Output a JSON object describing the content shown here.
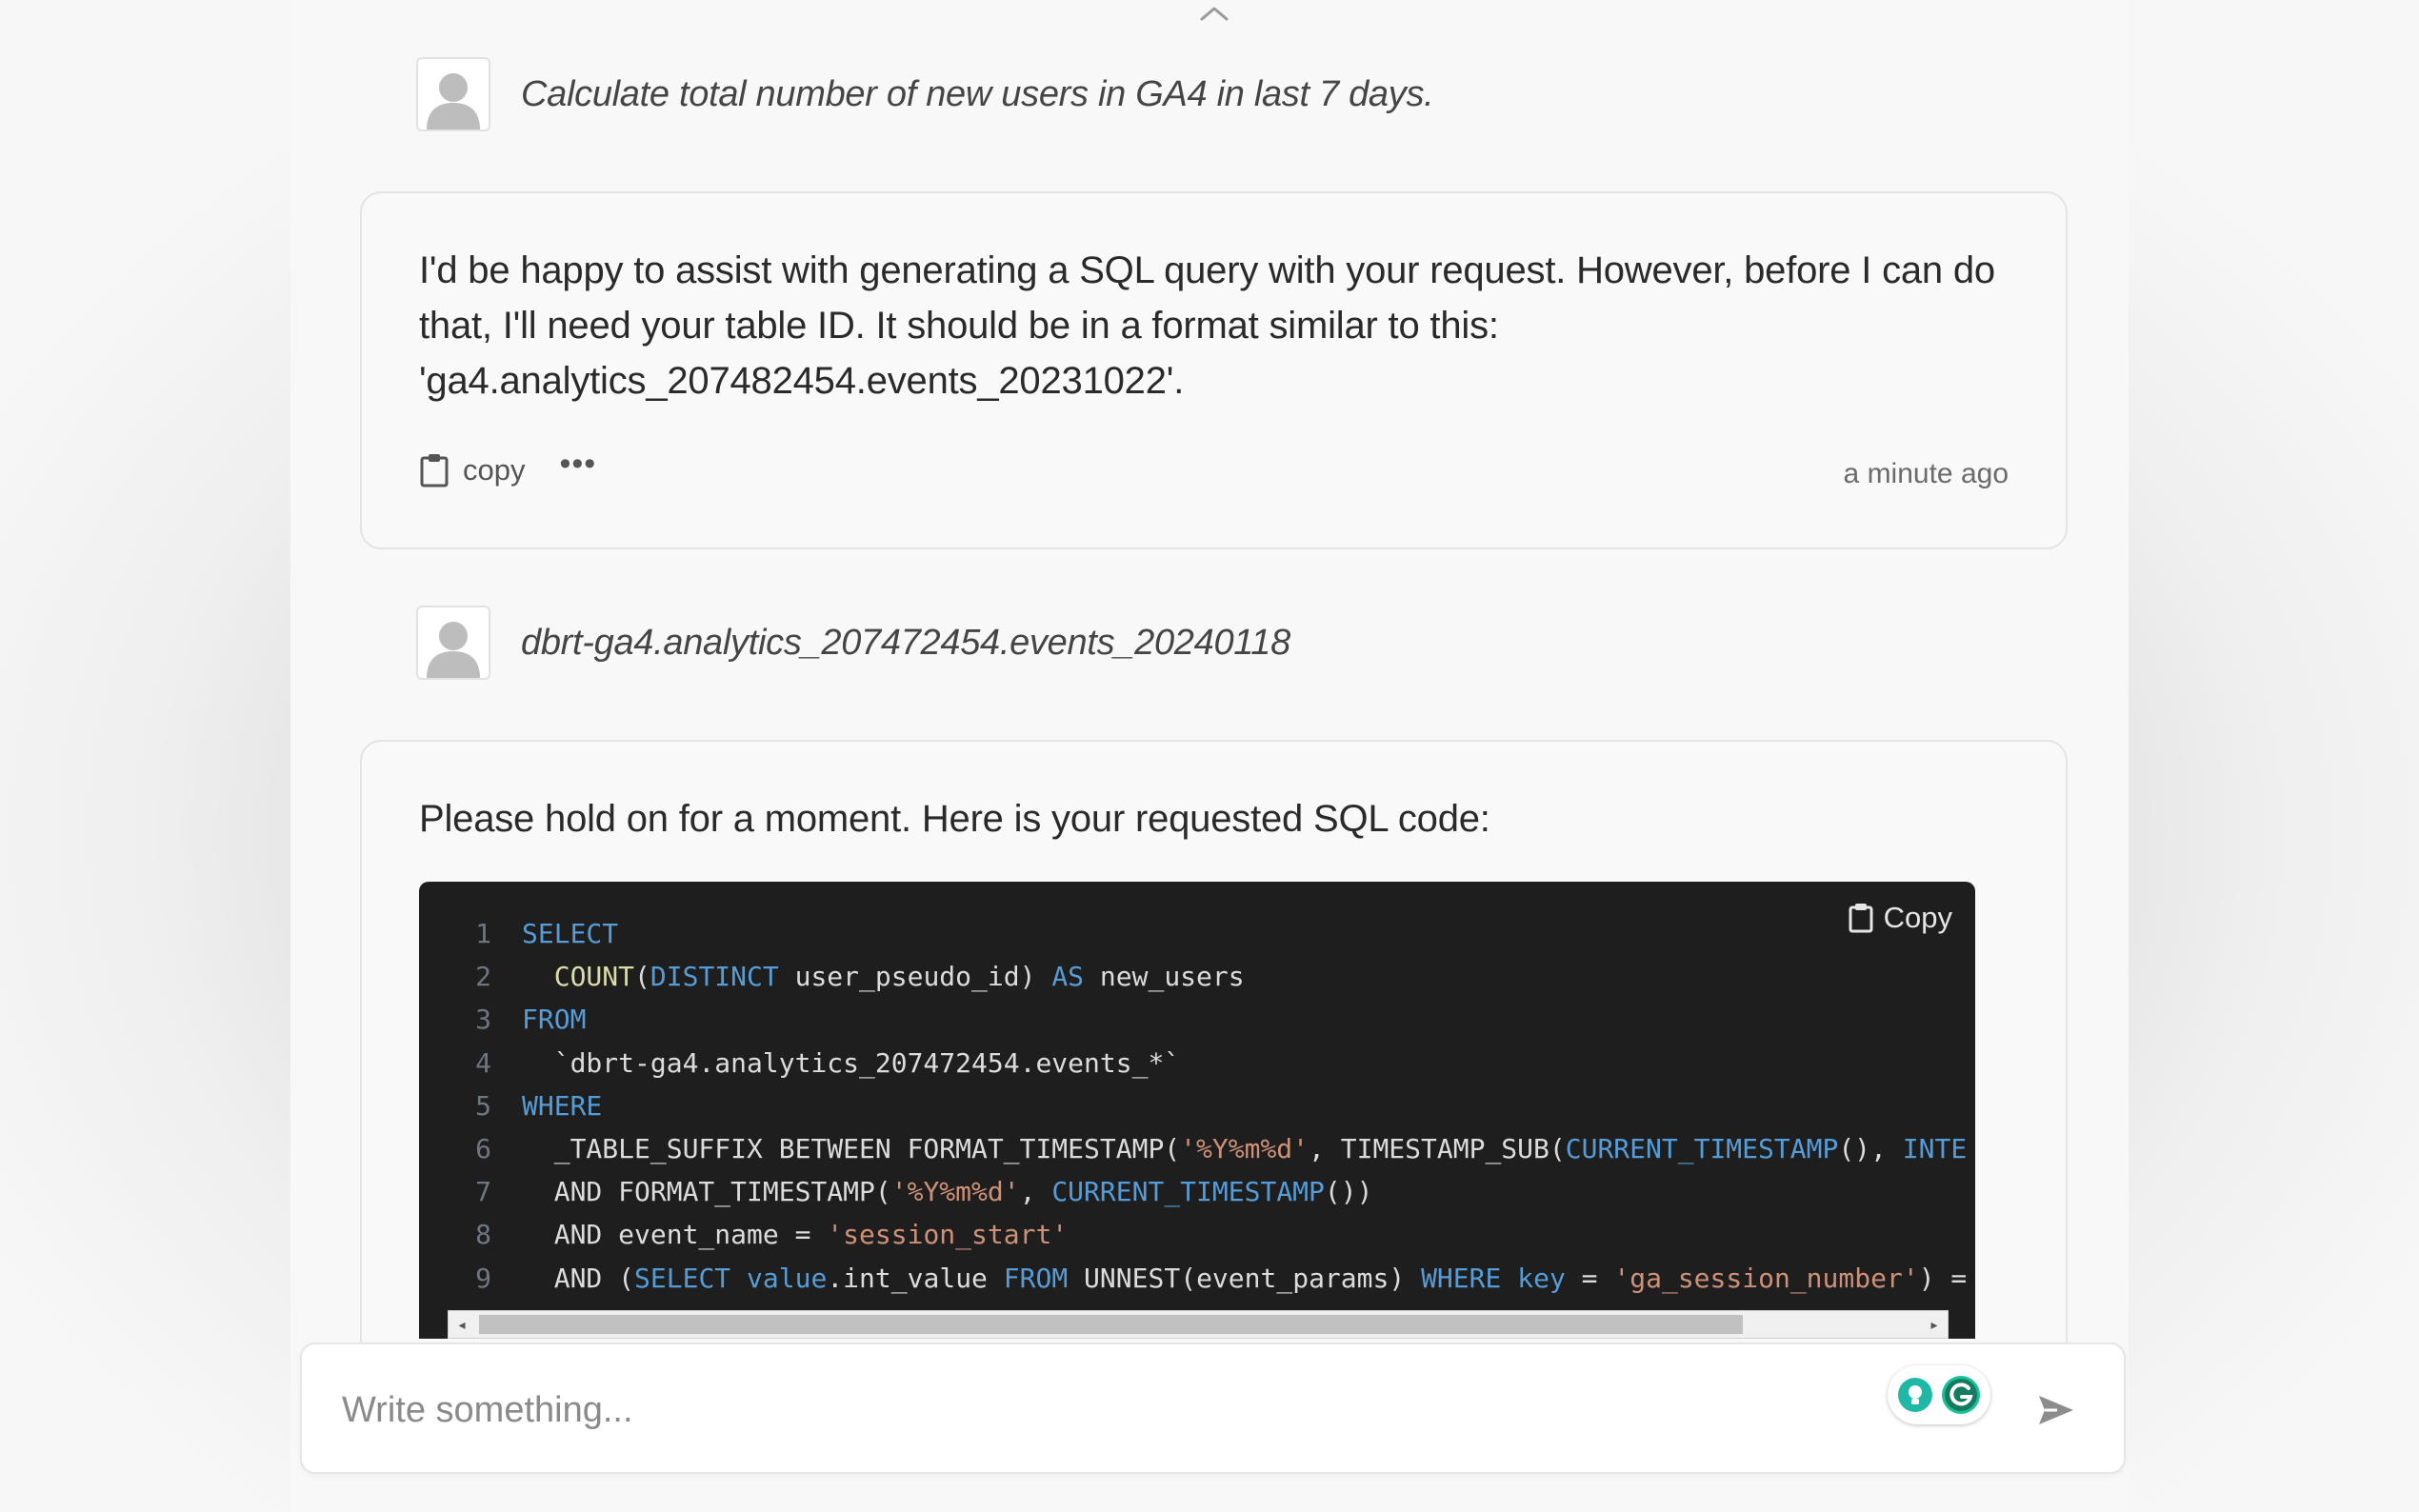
{
  "messages": [
    {
      "role": "user",
      "text": "Calculate total number of new users in GA4 in last 7 days."
    },
    {
      "role": "assistant",
      "text": "I'd be happy to assist with generating a SQL query with your request. However, before I can do that, I'll need your table ID. It should be in a format similar to this: 'ga4.analytics_207482454.events_20231022'.",
      "copy_label": "copy",
      "more_label": "•••",
      "timestamp": "a minute ago"
    },
    {
      "role": "user",
      "text": "dbrt-ga4.analytics_207472454.events_20240118"
    },
    {
      "role": "assistant",
      "text": "Please hold on for a moment. Here is your requested SQL code:",
      "code": {
        "copy_label": "Copy",
        "language": "sql",
        "lines": [
          {
            "num": "1",
            "tokens": [
              {
                "t": "SELECT",
                "c": "kw"
              }
            ]
          },
          {
            "num": "2",
            "tokens": [
              {
                "t": "  ",
                "c": ""
              },
              {
                "t": "COUNT",
                "c": "fn"
              },
              {
                "t": "(",
                "c": ""
              },
              {
                "t": "DISTINCT",
                "c": "kw"
              },
              {
                "t": " user_pseudo_id) ",
                "c": ""
              },
              {
                "t": "AS",
                "c": "kw"
              },
              {
                "t": " new_users",
                "c": ""
              }
            ]
          },
          {
            "num": "3",
            "tokens": [
              {
                "t": "FROM",
                "c": "kw"
              }
            ]
          },
          {
            "num": "4",
            "tokens": [
              {
                "t": "  `dbrt-ga4.analytics_207472454.events_*`",
                "c": "bt"
              }
            ]
          },
          {
            "num": "5",
            "tokens": [
              {
                "t": "WHERE",
                "c": "kw"
              }
            ]
          },
          {
            "num": "6",
            "tokens": [
              {
                "t": "  _TABLE_SUFFIX BETWEEN FORMAT_TIMESTAMP(",
                "c": ""
              },
              {
                "t": "'%Y%m%d'",
                "c": "str"
              },
              {
                "t": ", TIMESTAMP_SUB(",
                "c": ""
              },
              {
                "t": "CURRENT_TIMESTAMP",
                "c": "kw"
              },
              {
                "t": "(), ",
                "c": ""
              },
              {
                "t": "INTE",
                "c": "kw"
              }
            ]
          },
          {
            "num": "7",
            "tokens": [
              {
                "t": "  AND FORMAT_TIMESTAMP(",
                "c": ""
              },
              {
                "t": "'%Y%m%d'",
                "c": "str"
              },
              {
                "t": ", ",
                "c": ""
              },
              {
                "t": "CURRENT_TIMESTAMP",
                "c": "kw"
              },
              {
                "t": "())",
                "c": ""
              }
            ]
          },
          {
            "num": "8",
            "tokens": [
              {
                "t": "  AND event_name = ",
                "c": ""
              },
              {
                "t": "'session_start'",
                "c": "str"
              }
            ]
          },
          {
            "num": "9",
            "tokens": [
              {
                "t": "  AND (",
                "c": ""
              },
              {
                "t": "SELECT",
                "c": "kw"
              },
              {
                "t": " ",
                "c": ""
              },
              {
                "t": "value",
                "c": "kw"
              },
              {
                "t": ".int_value ",
                "c": ""
              },
              {
                "t": "FROM",
                "c": "kw"
              },
              {
                "t": " UNNEST(event_params) ",
                "c": ""
              },
              {
                "t": "WHERE",
                "c": "kw"
              },
              {
                "t": " ",
                "c": ""
              },
              {
                "t": "key",
                "c": "kw"
              },
              {
                "t": " = ",
                "c": ""
              },
              {
                "t": "'ga_session_number'",
                "c": "str"
              },
              {
                "t": ") =",
                "c": ""
              }
            ]
          }
        ]
      }
    }
  ],
  "composer": {
    "placeholder": "Write something..."
  },
  "icons": {
    "scroll_up": "chevron-up-icon",
    "avatar": "user-avatar-icon",
    "copy": "clipboard-icon",
    "more": "more-dots-icon",
    "send": "send-icon",
    "grammarly": "grammarly-icon"
  },
  "colors": {
    "code_bg": "#1e1e1e",
    "keyword": "#569cd6",
    "function": "#dcdcaa",
    "string": "#ce9178",
    "grammarly": "#15c39a"
  }
}
